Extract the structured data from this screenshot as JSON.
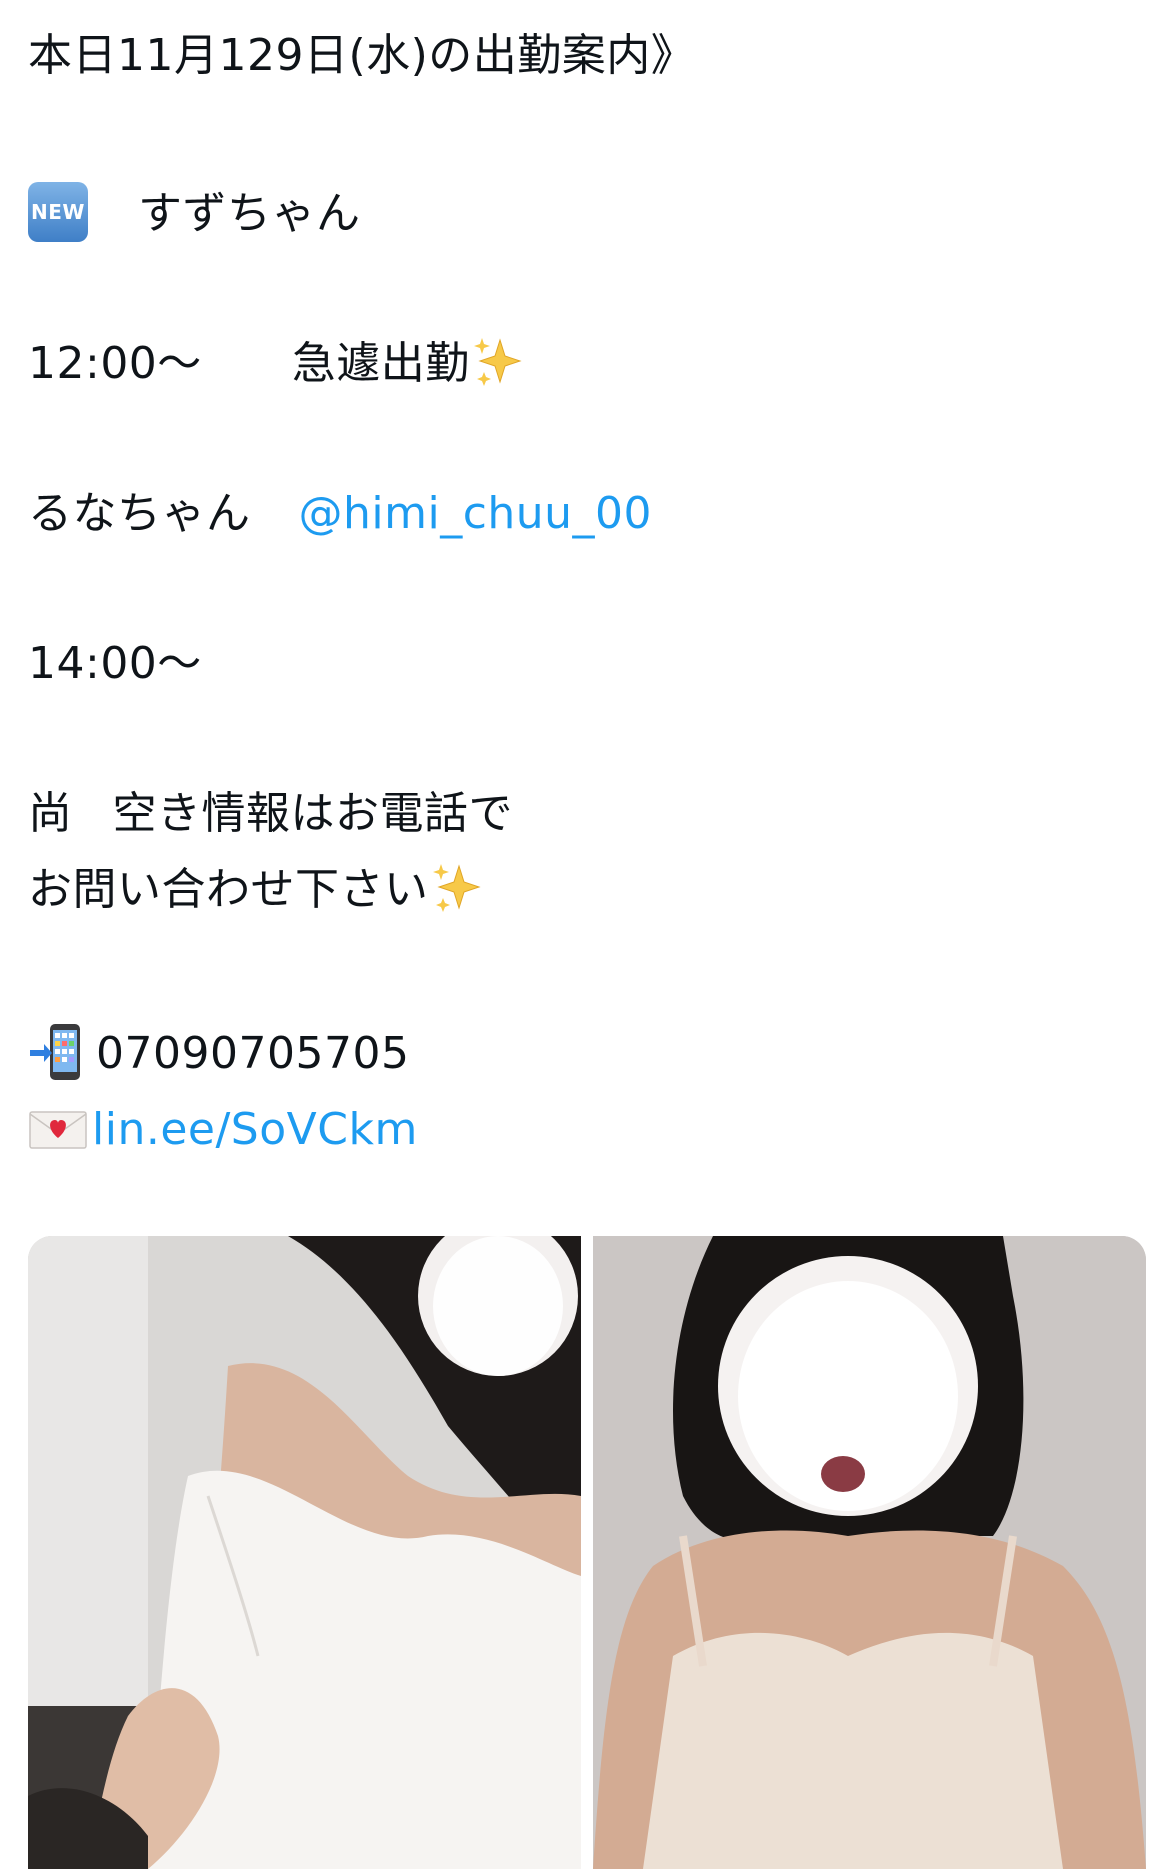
{
  "post": {
    "heading": "本日11月129日(水)の出勤案内》",
    "new_badge": "NEW",
    "entry1_name": "すずちゃん",
    "entry1_time": "12:00〜",
    "entry1_note": "急遽出勤",
    "entry2_name": "るなちゃん",
    "entry2_handle": "@himi_chuu_00",
    "entry2_time": "14:00〜",
    "notice_line1_prefix": "尚",
    "notice_line1": "空き情報はお電話で",
    "notice_line2": "お問い合わせ下さい",
    "phone": "07090705705",
    "line_link": "lin.ee/SoVCkm"
  },
  "icons": {
    "new": "new-badge-icon",
    "sparkles": "sparkles-icon",
    "phone": "mobile-phone-arrow-icon",
    "mail": "love-letter-icon"
  },
  "colors": {
    "text": "#0f1419",
    "link": "#1d9bf0",
    "background": "#ffffff"
  },
  "media": {
    "photos": [
      "photo-1",
      "photo-2"
    ]
  }
}
